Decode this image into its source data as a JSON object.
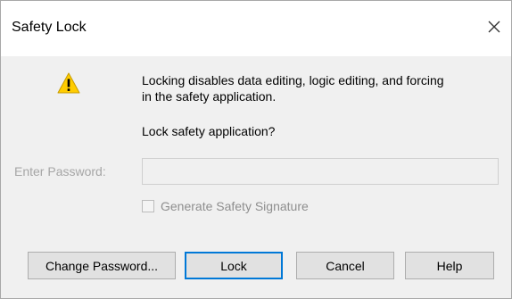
{
  "dialog": {
    "title": "Safety Lock",
    "close_icon": "close-icon"
  },
  "message": {
    "icon": "warning-icon",
    "line1": "Locking disables data editing, logic editing, and forcing",
    "line2": "in the safety application.",
    "question": "Lock safety application?"
  },
  "password": {
    "label": "Enter Password:",
    "value": ""
  },
  "signature": {
    "label": "Generate Safety Signature",
    "checked": false
  },
  "buttons": {
    "change_password": "Change Password...",
    "lock": "Lock",
    "cancel": "Cancel",
    "help": "Help"
  },
  "colors": {
    "focus_border": "#0078d7",
    "warning_yellow": "#ffcc00",
    "disabled_text": "#a6a6a6"
  }
}
